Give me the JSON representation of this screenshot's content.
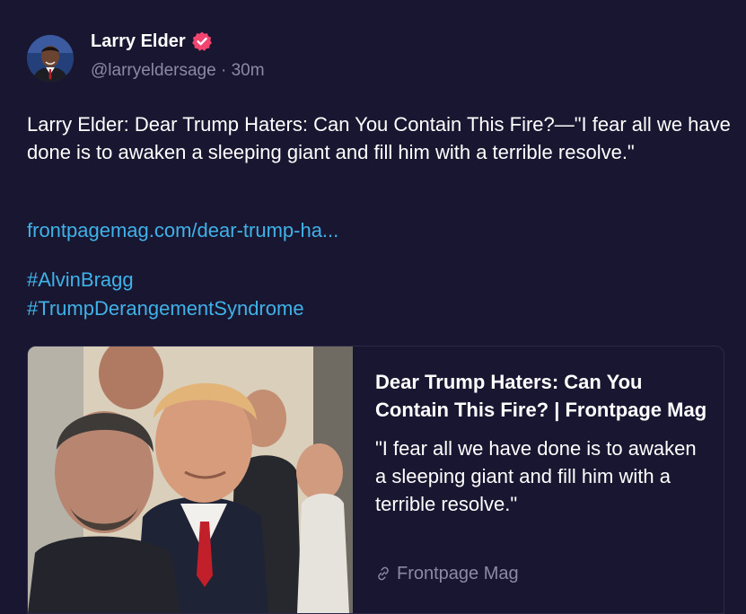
{
  "author": {
    "display_name": "Larry Elder",
    "verified": true,
    "handle": "@larryeldersage",
    "separator": "·",
    "time": "30m"
  },
  "post": {
    "text": "Larry Elder: Dear Trump Haters: Can You Contain This Fire?—\"I fear all we have done is to awaken a sleeping giant and fill him with a terrible resolve.\"",
    "link": "frontpagemag.com/dear-trump-ha...",
    "hashtags": [
      "#AlvinBragg",
      "#TrumpDerangementSyndrome"
    ]
  },
  "card": {
    "title": "Dear Trump Haters: Can You Contain This Fire? | Frontpage Mag",
    "description": "\"I fear all we have done is to awaken a sleeping giant and fill him with a terrible resolve.\"",
    "source": "Frontpage Mag",
    "source_icon": "link-icon",
    "image": "news-photo"
  },
  "colors": {
    "background": "#191631",
    "text": "#ffffff",
    "muted": "#8b8aa3",
    "link": "#3fb2e8",
    "verified_badge": "#f2446f"
  }
}
